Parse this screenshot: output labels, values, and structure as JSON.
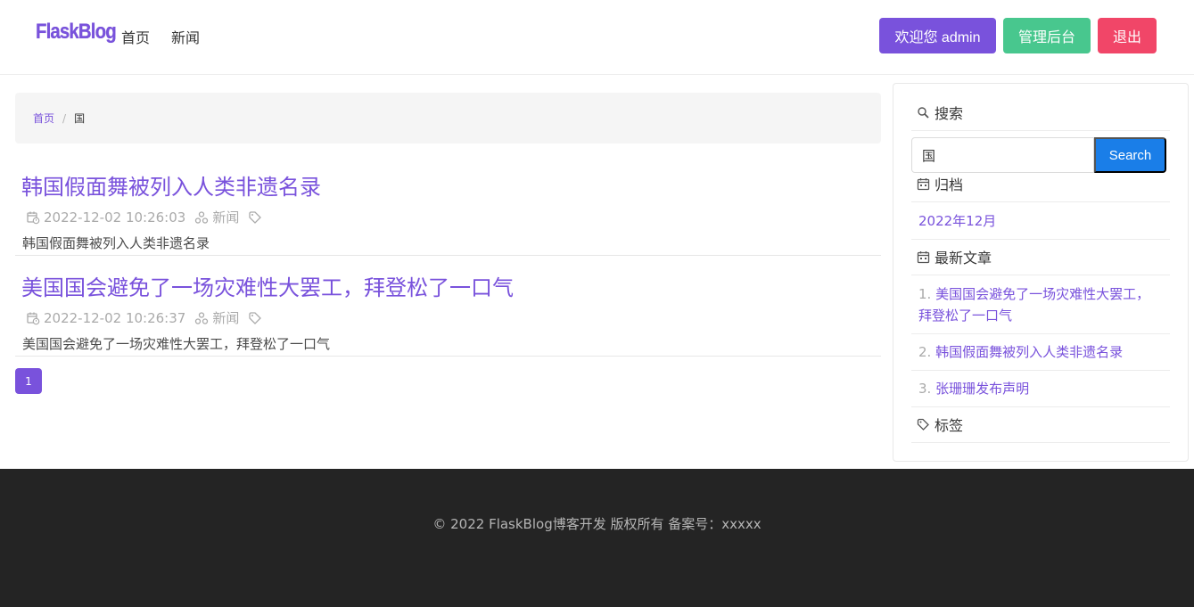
{
  "navbar": {
    "brand": "FlaskBlog",
    "links": [
      "首页",
      "新闻"
    ],
    "welcome_label": "欢迎您 admin",
    "admin_label": "管理后台",
    "logout_label": "退出",
    "colors": {
      "welcome": "#7952dc",
      "admin": "#48c78e",
      "logout": "#f14668"
    }
  },
  "breadcrumb": {
    "home": "首页",
    "separator": "/",
    "current": "国"
  },
  "posts": [
    {
      "title": "韩国假面舞被列入人类非遗名录",
      "datetime": "2022-12-02 10:26:03",
      "category": "新闻",
      "summary": "韩国假面舞被列入人类非遗名录"
    },
    {
      "title": "美国国会避免了一场灾难性大罢工，拜登松了一口气",
      "datetime": "2022-12-02 10:26:37",
      "category": "新闻",
      "summary": "美国国会避免了一场灾难性大罢工，拜登松了一口气"
    }
  ],
  "pagination": {
    "current": "1"
  },
  "sidebar": {
    "search": {
      "heading": "搜索",
      "value": "国",
      "button": "Search",
      "icon": "magnifier-icon"
    },
    "archive": {
      "heading": "归档",
      "items": [
        "2022年12月"
      ],
      "icon": "calendar-icon"
    },
    "latest": {
      "heading": "最新文章",
      "icon": "calendar-icon",
      "items": [
        {
          "num": "1.",
          "title": "美国国会避免了一场灾难性大罢工，拜登松了一口气"
        },
        {
          "num": "2.",
          "title": "韩国假面舞被列入人类非遗名录"
        },
        {
          "num": "3.",
          "title": "张珊珊发布声明"
        }
      ]
    },
    "tags": {
      "heading": "标签",
      "icon": "tag-icon"
    }
  },
  "footer": {
    "text": "© 2022 FlaskBlog博客开发 版权所有 备案号：xxxxx"
  },
  "colors": {
    "accent": "#7952dc",
    "search_button": "#1a7ee8",
    "footer_bg": "#242424"
  }
}
